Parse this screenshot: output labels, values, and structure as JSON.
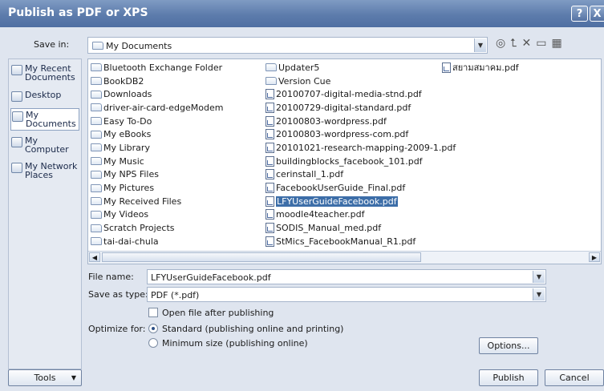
{
  "window": {
    "title": "Publish as PDF or XPS",
    "help": "?",
    "close": "X"
  },
  "save_in": {
    "label": "Save in:",
    "value": "My Documents"
  },
  "places": [
    {
      "label": "My Recent Documents"
    },
    {
      "label": "Desktop"
    },
    {
      "label": "My Documents"
    },
    {
      "label": "My Computer"
    },
    {
      "label": "My Network Places"
    }
  ],
  "files_col1": [
    "Bluetooth Exchange Folder",
    "BookDB2",
    "Downloads",
    "driver-air-card-edgeModem",
    "Easy To-Do",
    "My eBooks",
    "My Library",
    "My Music",
    "My NPS Files",
    "My Pictures",
    "My Received Files",
    "My Videos",
    "Scratch Projects",
    "tai-dai-chula"
  ],
  "files_col2": [
    "Updater5",
    "Version Cue",
    "20100707-digital-media-stnd.pdf",
    "20100729-digital-standard.pdf",
    "20100803-wordpress.pdf",
    "20100803-wordpress-com.pdf",
    "20101021-research-mapping-2009-1.pdf",
    "buildingblocks_facebook_101.pdf",
    "cerinstall_1.pdf",
    "FacebookUserGuide_Final.pdf",
    "LFYUserGuideFacebook.pdf",
    "moodle4teacher.pdf",
    "SODIS_Manual_med.pdf",
    "StMics_FacebookManual_R1.pdf"
  ],
  "files_col3": [
    "สยามสมาคม.pdf"
  ],
  "file_name": {
    "label": "File name:",
    "value": "LFYUserGuideFacebook.pdf"
  },
  "save_as_type": {
    "label": "Save as type:",
    "value": "PDF (*.pdf)"
  },
  "open_after": {
    "label": "Open file after publishing"
  },
  "optimize": {
    "label": "Optimize for:",
    "standard": "Standard (publishing online and printing)",
    "minimum": "Minimum size (publishing online)"
  },
  "buttons": {
    "options": "Options...",
    "tools": "Tools",
    "publish": "Publish",
    "cancel": "Cancel"
  }
}
